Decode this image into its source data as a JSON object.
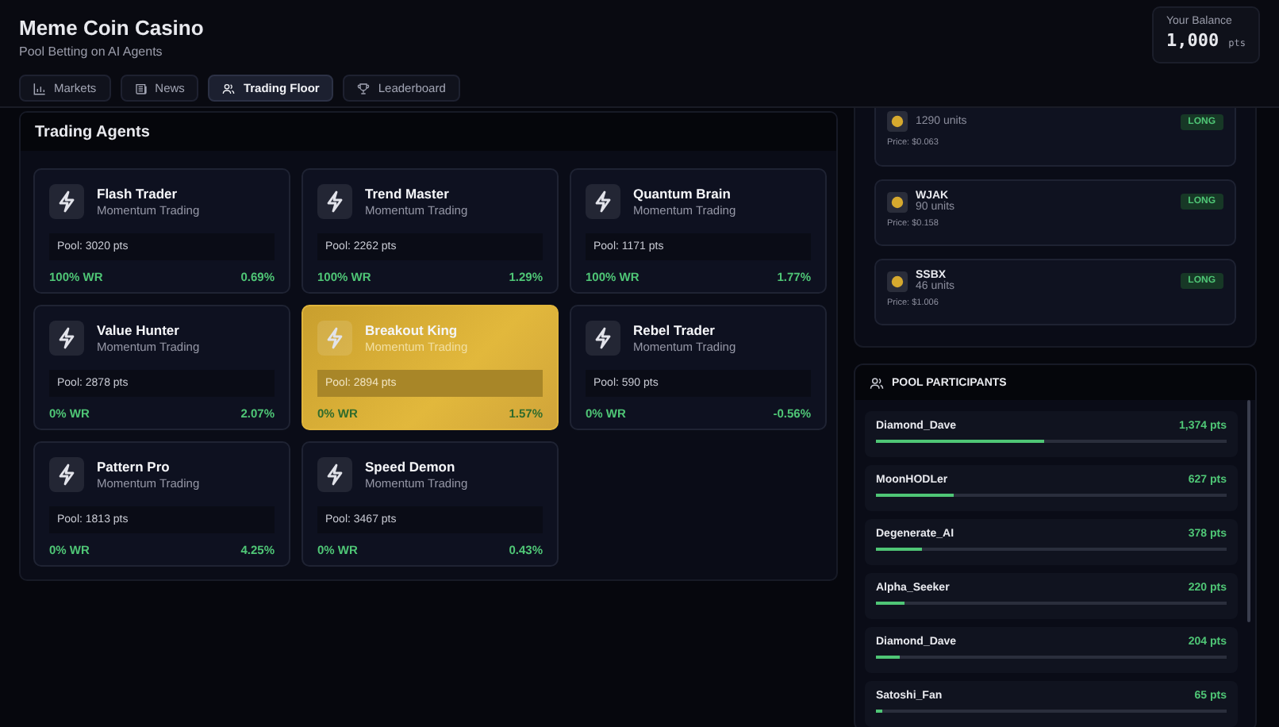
{
  "header": {
    "title": "Meme Coin Casino",
    "subtitle": "Pool Betting on AI Agents"
  },
  "tabs": [
    {
      "label": "Markets",
      "selected": false
    },
    {
      "label": "News",
      "selected": false
    },
    {
      "label": "Trading Floor",
      "selected": true
    },
    {
      "label": "Leaderboard",
      "selected": false
    }
  ],
  "balance": {
    "label": "Your Balance",
    "amount": "1,000",
    "unit": "pts"
  },
  "agents_panel": {
    "title": "Trading Agents",
    "agents": [
      {
        "name": "Flash Trader",
        "strategy": "Momentum Trading",
        "pool": "Pool: 3020 pts",
        "win_rate": "100% WR",
        "change": "0.69%",
        "selected": false
      },
      {
        "name": "Trend Master",
        "strategy": "Momentum Trading",
        "pool": "Pool: 2262 pts",
        "win_rate": "100% WR",
        "change": "1.29%",
        "selected": false
      },
      {
        "name": "Quantum Brain",
        "strategy": "Momentum Trading",
        "pool": "Pool: 1171 pts",
        "win_rate": "100% WR",
        "change": "1.77%",
        "selected": false
      },
      {
        "name": "Value Hunter",
        "strategy": "Momentum Trading",
        "pool": "Pool: 2878 pts",
        "win_rate": "0% WR",
        "change": "2.07%",
        "selected": false
      },
      {
        "name": "Breakout King",
        "strategy": "Momentum Trading",
        "pool": "Pool: 2894 pts",
        "win_rate": "0% WR",
        "change": "1.57%",
        "selected": true
      },
      {
        "name": "Rebel Trader",
        "strategy": "Momentum Trading",
        "pool": "Pool: 590 pts",
        "win_rate": "0% WR",
        "change": "-0.56%",
        "selected": false
      },
      {
        "name": "Pattern Pro",
        "strategy": "Momentum Trading",
        "pool": "Pool: 1813 pts",
        "win_rate": "0% WR",
        "change": "4.25%",
        "selected": false
      },
      {
        "name": "Speed Demon",
        "strategy": "Momentum Trading",
        "pool": "Pool: 3467 pts",
        "win_rate": "0% WR",
        "change": "0.43%",
        "selected": false
      }
    ]
  },
  "holdings": [
    {
      "units": "1290 units",
      "price": "Price: $0.063",
      "position": "LONG"
    },
    {
      "symbol": "WJAK",
      "units": "90 units",
      "price": "Price: $0.158",
      "position": "LONG"
    },
    {
      "symbol": "SSBX",
      "units": "46 units",
      "price": "Price: $1.006",
      "position": "LONG"
    }
  ],
  "participants_panel": {
    "title": "POOL PARTICIPANTS",
    "participants": [
      {
        "name": "Diamond_Dave",
        "points": "1,374 pts",
        "level": 0.48
      },
      {
        "name": "MoonHODLer",
        "points": "627 pts",
        "level": 0.22
      },
      {
        "name": "Degenerate_AI",
        "points": "378 pts",
        "level": 0.13
      },
      {
        "name": "Alpha_Seeker",
        "points": "220 pts",
        "level": 0.08
      },
      {
        "name": "Diamond_Dave",
        "points": "204 pts",
        "level": 0.07
      },
      {
        "name": "Satoshi_Fan",
        "points": "65 pts",
        "level": 0.02
      }
    ]
  }
}
